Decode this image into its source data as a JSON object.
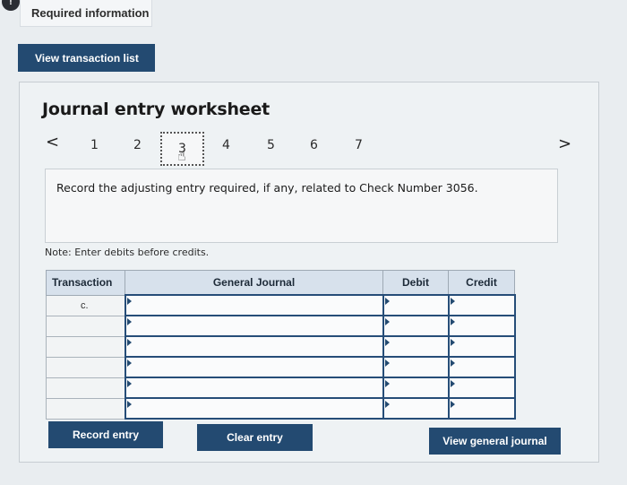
{
  "header": {
    "alert_symbol": "!",
    "required_info_label": "Required information"
  },
  "actions": {
    "view_transactions_label": "View transaction list",
    "record_entry_label": "Record entry",
    "clear_entry_label": "Clear entry",
    "view_general_journal_label": "View general journal"
  },
  "worksheet": {
    "title": "Journal entry worksheet",
    "nav": {
      "prev_symbol": "<",
      "next_symbol": ">",
      "steps": [
        "1",
        "2",
        "3",
        "4",
        "5",
        "6",
        "7"
      ],
      "active_step": "3"
    },
    "instruction": "Record the adjusting entry required, if any, related to Check Number 3056.",
    "note": "Note: Enter debits before credits."
  },
  "journal_table": {
    "headers": {
      "transaction": "Transaction",
      "general_journal": "General Journal",
      "debit": "Debit",
      "credit": "Credit"
    },
    "rows": [
      {
        "transaction": "c.",
        "account": "",
        "debit": "",
        "credit": ""
      },
      {
        "transaction": "",
        "account": "",
        "debit": "",
        "credit": ""
      },
      {
        "transaction": "",
        "account": "",
        "debit": "",
        "credit": ""
      },
      {
        "transaction": "",
        "account": "",
        "debit": "",
        "credit": ""
      },
      {
        "transaction": "",
        "account": "",
        "debit": "",
        "credit": ""
      },
      {
        "transaction": "",
        "account": "",
        "debit": "",
        "credit": ""
      }
    ]
  },
  "colors": {
    "primary_button": "#234a71",
    "table_header": "#d7e1ec",
    "page_background": "#e9edf0"
  }
}
